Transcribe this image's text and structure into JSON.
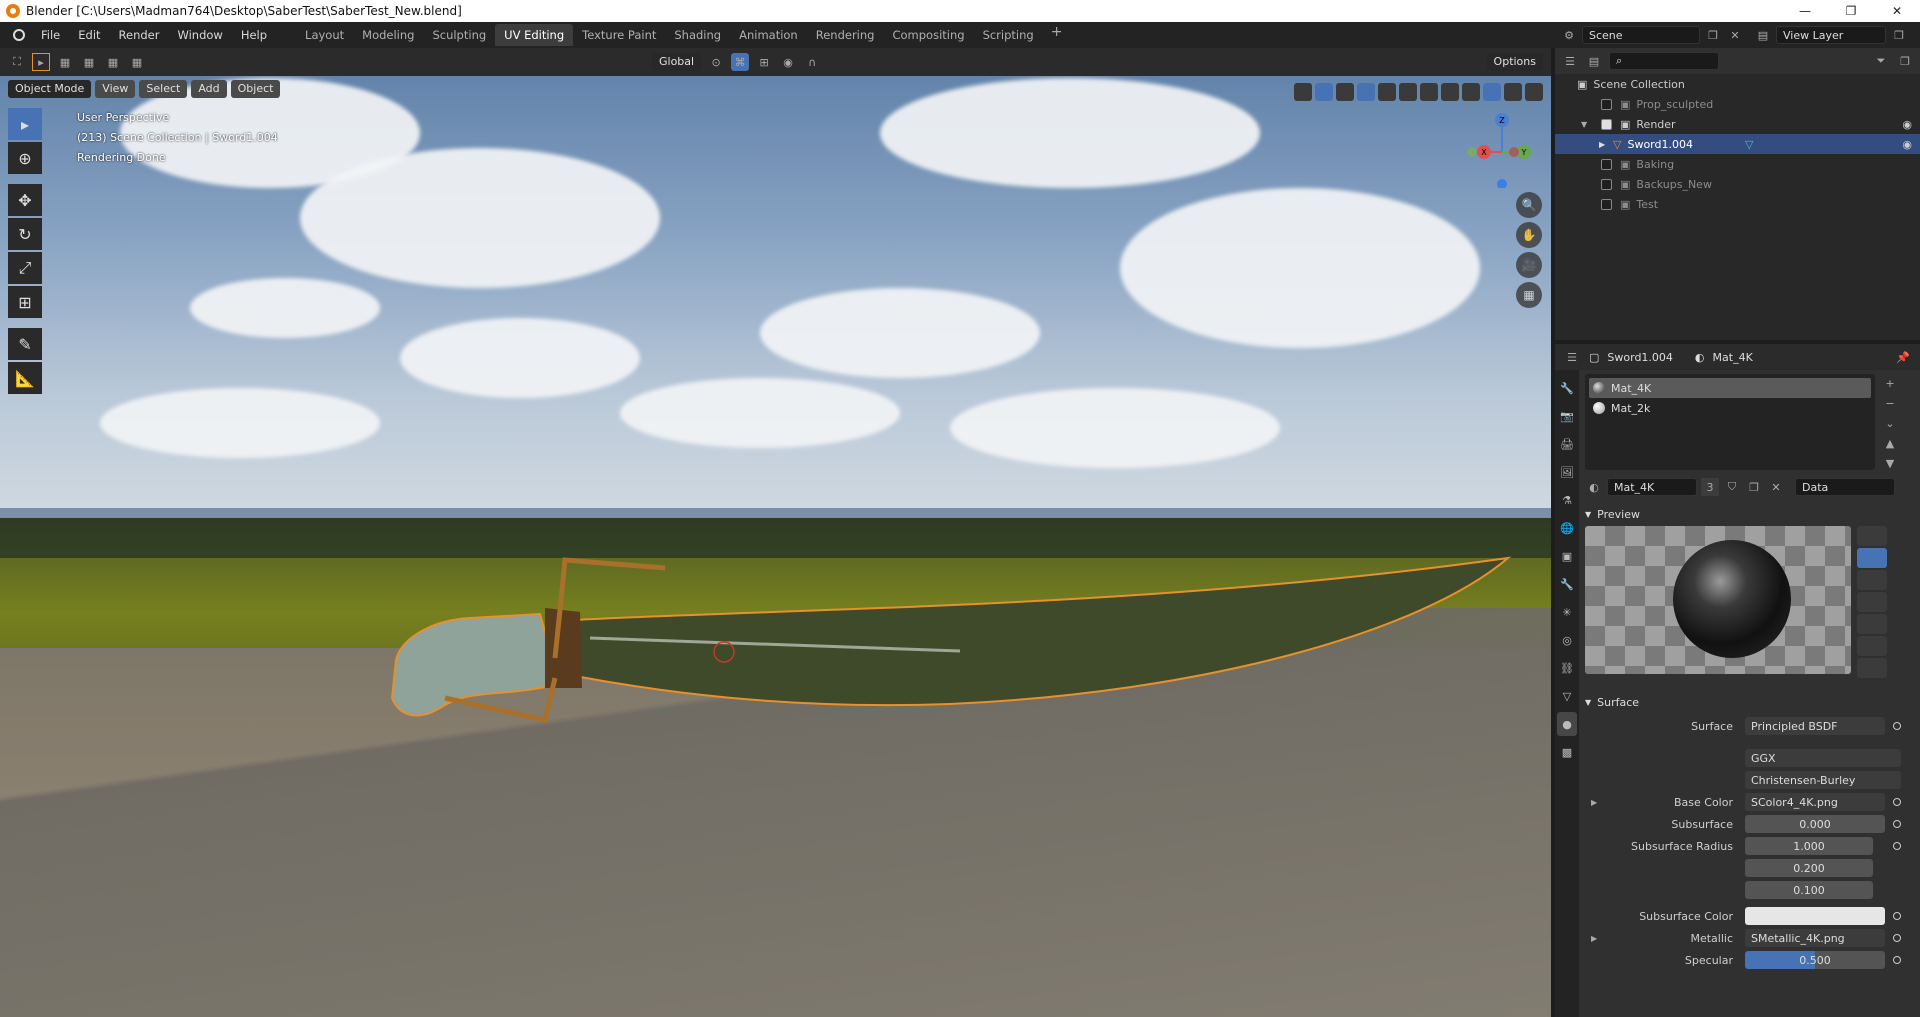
{
  "window": {
    "title": "Blender [C:\\Users\\Madman764\\Desktop\\SaberTest\\SaberTest_New.blend]",
    "controls": [
      "—",
      "❐",
      "✕"
    ]
  },
  "menu": [
    "File",
    "Edit",
    "Render",
    "Window",
    "Help"
  ],
  "workspaces": {
    "tabs": [
      "Layout",
      "Modeling",
      "Sculpting",
      "UV Editing",
      "Texture Paint",
      "Shading",
      "Animation",
      "Rendering",
      "Compositing",
      "Scripting"
    ],
    "active": "UV Editing",
    "add": "+"
  },
  "scene": {
    "name": "Scene"
  },
  "view_layer": {
    "name": "View Layer"
  },
  "viewport": {
    "mode": "Object Mode",
    "menus": [
      "View",
      "Select",
      "Add",
      "Object"
    ],
    "transform": "Global",
    "options": "Options",
    "overlay_lines": [
      "User Perspective",
      "(213) Scene Collection | Sword1.004",
      "Rendering Done"
    ],
    "gizmo_labels": {
      "z": "Z",
      "x": "X",
      "y": "Y"
    },
    "accent": "#4772b3"
  },
  "outliner": {
    "root": "Scene Collection",
    "items": [
      {
        "label": "Prop_sculpted",
        "checked": false,
        "dim": true
      },
      {
        "label": "Render",
        "checked": true,
        "dim": false
      },
      {
        "label": "Sword1.004",
        "checked": false,
        "dim": false,
        "selected": true
      },
      {
        "label": "Baking",
        "checked": false,
        "dim": true
      },
      {
        "label": "Backups_New",
        "checked": false,
        "dim": true
      },
      {
        "label": "Test",
        "checked": false,
        "dim": true
      }
    ]
  },
  "properties": {
    "object": "Sword1.004",
    "material": "Mat_4K",
    "slots": [
      "Mat_4K",
      "Mat_2k"
    ],
    "datablock": {
      "name": "Mat_4K",
      "users": "3",
      "link": "Data"
    },
    "panels": {
      "preview": "Preview",
      "surface": "Surface"
    },
    "surface": [
      {
        "label": "Surface",
        "value": "Principled BSDF",
        "kind": "text"
      },
      {
        "label": "",
        "value": "GGX",
        "kind": "text"
      },
      {
        "label": "",
        "value": "Christensen-Burley",
        "kind": "text"
      },
      {
        "label": "Base Color",
        "value": "SColor4_4K.png",
        "kind": "text"
      },
      {
        "label": "Subsurface",
        "value": "0.000",
        "kind": "num"
      },
      {
        "label": "Subsurface Radius",
        "value": "1.000",
        "kind": "num"
      },
      {
        "label": "",
        "value": "0.200",
        "kind": "num"
      },
      {
        "label": "",
        "value": "0.100",
        "kind": "num"
      },
      {
        "label": "Subsurface Color",
        "value": "",
        "kind": "white"
      },
      {
        "label": "Metallic",
        "value": "SMetallic_4K.png",
        "kind": "text"
      },
      {
        "label": "Specular",
        "value": "0.500",
        "kind": "slider"
      }
    ]
  }
}
